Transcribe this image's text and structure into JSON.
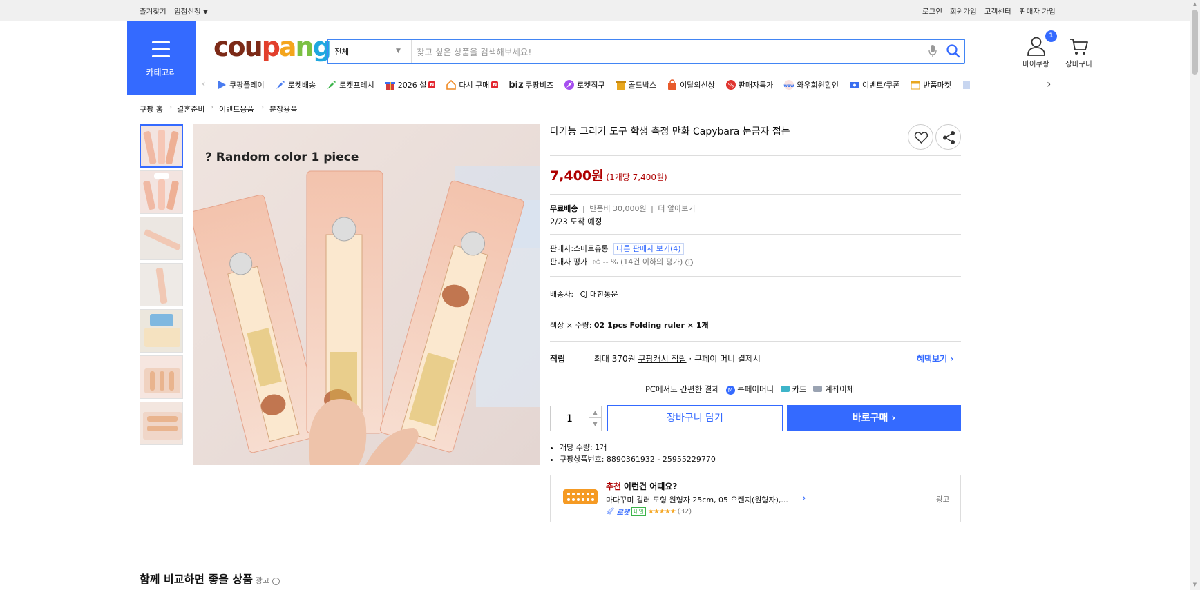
{
  "topbar": {
    "left": [
      "즐겨찾기",
      "입점신청"
    ],
    "right": [
      "로그인",
      "회원가입",
      "고객센터",
      "판매자 가입"
    ]
  },
  "header": {
    "category_label": "카테고리",
    "logo": [
      "cou",
      "p",
      "a",
      "n",
      "g"
    ],
    "search": {
      "selected": "전체",
      "placeholder": "찾고 싶은 상품을 검색해보세요!"
    },
    "my_coupang": "마이쿠팡",
    "cart": "장바구니",
    "cart_count": "1"
  },
  "gnb": [
    {
      "label": "쿠팡플레이",
      "color": "#4a7cf0",
      "new": false
    },
    {
      "label": "로켓배송",
      "color": "#4a7cf0",
      "new": false
    },
    {
      "label": "로켓프레시",
      "color": "#3bb44a",
      "new": false
    },
    {
      "label": "2026 설",
      "color": "#d23b3b",
      "new": true
    },
    {
      "label": "다시 구매",
      "color": "#f08a24",
      "new": true
    },
    {
      "label": "쿠팡비즈",
      "color": "#222",
      "prefix": "biz",
      "new": false
    },
    {
      "label": "로켓직구",
      "color": "#a64ff0",
      "new": false
    },
    {
      "label": "골드박스",
      "color": "#e8a71e",
      "new": false
    },
    {
      "label": "이달의신상",
      "color": "#e85a2b",
      "new": false
    },
    {
      "label": "판매자특가",
      "color": "#e0342f",
      "new": false
    },
    {
      "label": "와우회원할인",
      "color": "#2a6cf0",
      "new": false
    },
    {
      "label": "이벤트/쿠폰",
      "color": "#3a6ff0",
      "new": false
    },
    {
      "label": "반품마켓",
      "color": "#e8a71e",
      "new": false
    }
  ],
  "breadcrumb": [
    "쿠팡 홈",
    "결혼준비",
    "이벤트용품",
    "분장용품"
  ],
  "product": {
    "title": "다기능 그리기 도구 학생 측정 만화 Capybara 눈금자 접는",
    "image_caption": "? Random color 1 piece",
    "price": "7,400원",
    "unit_price": "(1개당 7,400원)",
    "shipping": {
      "free": "무료배송",
      "return_fee": "반품비 30,000원",
      "more": "더 알아보기",
      "arrival": "2/23 도착 예정"
    },
    "seller": {
      "label": "판매자:",
      "name": "스마트유통",
      "other": "다른 판매자 보기(4)",
      "rating_label": "판매자 평가",
      "rating_value": "-- %",
      "rating_note": "(14건 이하의 평가)"
    },
    "carrier": {
      "label": "배송사:",
      "name": "CJ 대한통운"
    },
    "option": {
      "label": "색상 × 수량:",
      "value": "02 1pcs Folding ruler × 1개"
    },
    "reward": {
      "label": "적립",
      "text_pre": "최대 370원",
      "link": "쿠팡캐시 적립",
      "text_post": "· 쿠페이 머니 결제시",
      "benefit": "혜택보기"
    },
    "pc_pay": {
      "title": "PC에서도 간편한 결제",
      "methods": [
        "쿠페이머니",
        "카드",
        "계좌이체"
      ]
    },
    "quantity": "1",
    "add_cart": "장바구니 담기",
    "buy_now": "바로구매",
    "details": [
      "개당 수량: 1개",
      "쿠팡상품번호: 8890361932 - 25955229770"
    ]
  },
  "recommend": {
    "highlight": "추천",
    "title": "이런건 어때요?",
    "product": "마다꾸미 컬러 도형 원형자 25cm, 05 오렌지(원형자),...",
    "badge_rocket": "로켓",
    "badge_tomorrow": "내일",
    "reviews": "(32)",
    "ad": "광고"
  },
  "compare": {
    "title": "함께 비교하면 좋을 상품",
    "ad": "광고"
  }
}
